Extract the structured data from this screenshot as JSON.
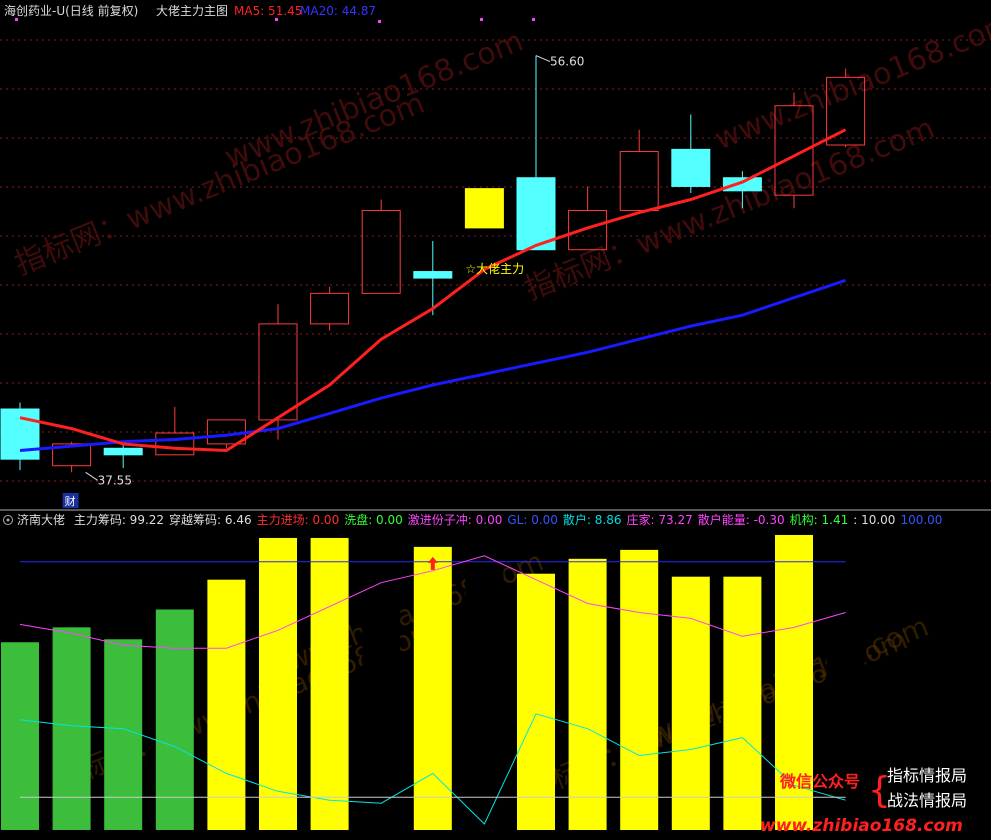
{
  "colors": {
    "background": "#000000",
    "up": "#ff3b3b",
    "down": "#54ffff",
    "ma5": "#ff2020",
    "ma20": "#1a1aff",
    "yellow": "#ffff00",
    "green": "#3cbd3c",
    "magenta": "#ff44ff",
    "cyan": "#00e5e5",
    "white": "#cccccc",
    "grid": "#8a1a1a"
  },
  "header": {
    "title": "海创药业-U(日线 前复权)",
    "indicator": "大佬主力主图",
    "ma5": "MA5: 51.45",
    "ma20": "MA20: 44.87"
  },
  "chart_data": [
    {
      "type": "candlestick",
      "ylim": [
        36,
        58
      ],
      "grid": true,
      "candles": [
        {
          "o": 40.4,
          "h": 40.7,
          "l": 37.6,
          "c": 38.1
        },
        {
          "o": 37.8,
          "h": 38.9,
          "l": 37.5,
          "c": 38.8
        },
        {
          "o": 38.6,
          "h": 38.8,
          "l": 37.7,
          "c": 38.3
        },
        {
          "o": 38.3,
          "h": 40.5,
          "l": 38.3,
          "c": 39.3
        },
        {
          "o": 38.8,
          "h": 39.9,
          "l": 38.6,
          "c": 39.9
        },
        {
          "o": 39.9,
          "h": 45.2,
          "l": 39.0,
          "c": 44.3
        },
        {
          "o": 44.3,
          "h": 46.0,
          "l": 44.0,
          "c": 45.7
        },
        {
          "o": 45.7,
          "h": 50.0,
          "l": 45.7,
          "c": 49.5
        },
        {
          "o": 46.7,
          "h": 48.1,
          "l": 44.7,
          "c": 46.4
        },
        {
          "o": 50.5,
          "h": 50.5,
          "l": 48.7,
          "c": 48.7
        },
        {
          "o": 51.0,
          "h": 56.6,
          "l": 48.7,
          "c": 47.7
        },
        {
          "o": 47.7,
          "h": 50.6,
          "l": 47.7,
          "c": 49.5
        },
        {
          "o": 49.5,
          "h": 53.2,
          "l": 49.5,
          "c": 52.2
        },
        {
          "o": 52.3,
          "h": 53.9,
          "l": 50.3,
          "c": 50.6
        },
        {
          "o": 51.0,
          "h": 51.3,
          "l": 49.6,
          "c": 50.4
        },
        {
          "o": 50.2,
          "h": 54.9,
          "l": 49.6,
          "c": 54.3
        },
        {
          "o": 52.5,
          "h": 56.0,
          "l": 52.4,
          "c": 55.6
        }
      ],
      "series": [
        {
          "name": "MA5",
          "values": [
            40.0,
            39.5,
            38.8,
            38.6,
            38.5,
            40.0,
            41.5,
            43.6,
            45.0,
            46.8,
            47.9,
            48.7,
            49.4,
            50.0,
            50.8,
            52.0,
            53.2
          ]
        },
        {
          "name": "MA20",
          "values": [
            38.5,
            38.7,
            38.9,
            39.0,
            39.2,
            39.5,
            40.2,
            40.9,
            41.5,
            42.0,
            42.5,
            43.0,
            43.6,
            44.2,
            44.7,
            45.5,
            46.3
          ]
        }
      ],
      "annotations": {
        "high_label": "56.60",
        "low_label": "37.55",
        "signal_label": "☆大佬主力",
        "fin_label": "财"
      },
      "watermarks": [
        "www.zhibiao168.com",
        "指标网：www.zhibiao168.com",
        "指标网：www.zhibiao168.com",
        "www.zhibiao168.com"
      ]
    },
    {
      "type": "bar",
      "title": "济南大佬",
      "legend": [
        {
          "text": "主力筹码: 99.22",
          "color": "#dddddd"
        },
        {
          "text": "穿越筹码: 6.46",
          "color": "#dddddd"
        },
        {
          "text": "主力进场: 0.00",
          "color": "#ff3030"
        },
        {
          "text": "洗盘: 0.00",
          "color": "#33ff33"
        },
        {
          "text": "激进份子冲: 0.00",
          "color": "#ff44ff"
        },
        {
          "text": "GL: 0.00",
          "color": "#3355ff"
        },
        {
          "text": "散户: 8.86",
          "color": "#00dede"
        },
        {
          "text": "庄家: 73.27",
          "color": "#ff44ff"
        },
        {
          "text": "散户能量: -0.30",
          "color": "#ff44ff"
        },
        {
          "text": "机构: 1.41",
          "color": "#33ff33"
        },
        {
          "text": ": 10.00",
          "color": "#dddddd"
        },
        {
          "text": "100.00",
          "color": "#3355ff"
        }
      ],
      "ylim": [
        0,
        100
      ],
      "reference_line": 90,
      "bars": [
        {
          "value": 63,
          "color": "green"
        },
        {
          "value": 68,
          "color": "green"
        },
        {
          "value": 64,
          "color": "green"
        },
        {
          "value": 74,
          "color": "green"
        },
        {
          "value": 84,
          "color": "yellow"
        },
        {
          "value": 98,
          "color": "yellow"
        },
        {
          "value": 98,
          "color": "yellow"
        },
        {
          "value": 100,
          "color": "red"
        },
        {
          "value": 95,
          "color": "yellow"
        },
        {
          "value": 100,
          "color": "red"
        },
        {
          "value": 86,
          "color": "yellow"
        },
        {
          "value": 91,
          "color": "yellow"
        },
        {
          "value": 94,
          "color": "yellow"
        },
        {
          "value": 85,
          "color": "yellow"
        },
        {
          "value": 85,
          "color": "yellow"
        },
        {
          "value": 99,
          "color": "yellow"
        },
        {
          "value": 100,
          "color": "red"
        }
      ],
      "series": [
        {
          "name": "庄家",
          "values": [
            69,
            66,
            62,
            61,
            61,
            67,
            75,
            83,
            87,
            92,
            84,
            76,
            73,
            71,
            65,
            68,
            73
          ],
          "color": "magenta"
        },
        {
          "name": "散户",
          "values": [
            37,
            35,
            34,
            28,
            19,
            13,
            10,
            9,
            19,
            2,
            39,
            34,
            25,
            27,
            31,
            15,
            10
          ],
          "color": "cyan"
        },
        {
          "name": "white-line",
          "values": [
            11,
            11,
            11,
            11,
            11,
            11,
            11,
            11,
            11,
            11,
            11,
            11,
            11,
            11,
            11,
            11,
            11
          ],
          "color": "white"
        }
      ],
      "signal_arrow_index": 8,
      "footer_brand": {
        "wechat": "微信公众号",
        "line1": "指标情报局",
        "line2": "战法情报局",
        "site": "www.zhibiao168.com"
      },
      "watermarks": [
        "www.zhibiao168.com",
        "www.zhibiao168.com",
        "指标网：www.zhibiao168.com",
        "指标网：www.zhibiao168.com"
      ]
    }
  ]
}
